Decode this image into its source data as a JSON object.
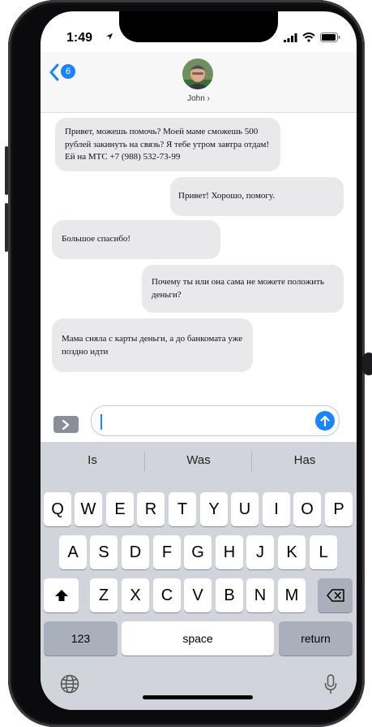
{
  "status_bar": {
    "time": "1:49"
  },
  "header": {
    "back_count": "6",
    "contact_name": "John ›"
  },
  "messages": [
    {
      "side": "left",
      "text": "Привет, можешь помочь? Моей маме сможешь 500 рублей закинуть на связь? Я тебе утром завтра отдам! Ей на МТС +7 (988) 532-73-99"
    },
    {
      "side": "right",
      "text": "Привет! Хорошо, помогу."
    },
    {
      "side": "left",
      "text": "Большое спасибо!"
    },
    {
      "side": "right",
      "text": "Почему ты или она сама не можете положить деньги?"
    },
    {
      "side": "left",
      "text": "Мама сняла с карты деньги, а до банкомата уже поздно идти"
    }
  ],
  "compose": {
    "value": ""
  },
  "keyboard": {
    "suggestions": [
      "Is",
      "Was",
      "Has"
    ],
    "row1": [
      "Q",
      "W",
      "E",
      "R",
      "T",
      "Y",
      "U",
      "I",
      "O",
      "P"
    ],
    "row2": [
      "A",
      "S",
      "D",
      "F",
      "G",
      "H",
      "J",
      "K",
      "L"
    ],
    "row3": [
      "Z",
      "X",
      "C",
      "V",
      "B",
      "N",
      "M"
    ],
    "numbers_label": "123",
    "space_label": "space",
    "return_label": "return"
  },
  "colors": {
    "accent": "#1a84ff",
    "bubble": "#e9e9eb",
    "keyboard_bg": "#d1d4da"
  }
}
